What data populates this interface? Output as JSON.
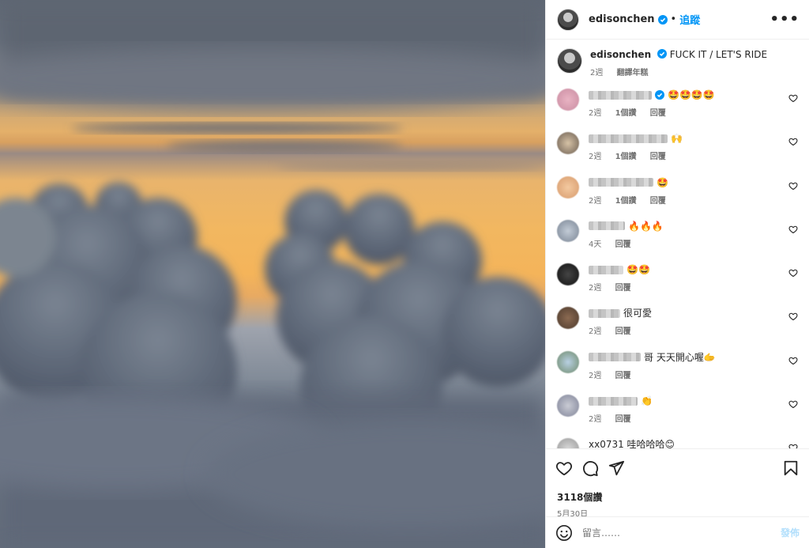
{
  "post": {
    "username": "edisonchen",
    "follow_label": "追蹤",
    "more_label": "•••",
    "caption_text": "FUCK IT / LET'S RIDE",
    "caption_time": "2週",
    "caption_action": "翻譯年糕"
  },
  "comments": [
    {
      "text": "🤩🤩🤩🤩",
      "time": "2週",
      "likes": "1個讚",
      "reply": "回覆",
      "verified": true
    },
    {
      "text": "🙌",
      "time": "2週",
      "likes": "1個讚",
      "reply": "回覆",
      "verified": false
    },
    {
      "text": "🤩",
      "time": "2週",
      "likes": "1個讚",
      "reply": "回覆",
      "verified": false
    },
    {
      "text": "🔥🔥🔥",
      "time": "4天",
      "likes": "",
      "reply": "回覆",
      "verified": false
    },
    {
      "text": "🤩🤩",
      "time": "2週",
      "likes": "",
      "reply": "回覆",
      "verified": false
    },
    {
      "text": "很可愛",
      "time": "2週",
      "likes": "",
      "reply": "回覆",
      "verified": false
    },
    {
      "text": "哥 天天開心喔🫱",
      "time": "2週",
      "likes": "",
      "reply": "回覆",
      "verified": false
    },
    {
      "text": "👏",
      "time": "2週",
      "likes": "",
      "reply": "回覆",
      "verified": false
    },
    {
      "text": "xx0731 哇哈哈哈😊",
      "time": "",
      "likes": "",
      "reply": "",
      "verified": false
    }
  ],
  "footer": {
    "likes_count": "3118個讚",
    "date": "5月30日",
    "comment_placeholder": "留言……",
    "post_label": "發佈"
  },
  "colors": {
    "accent": "#0095f6",
    "post_disabled": "#b2dffc"
  }
}
